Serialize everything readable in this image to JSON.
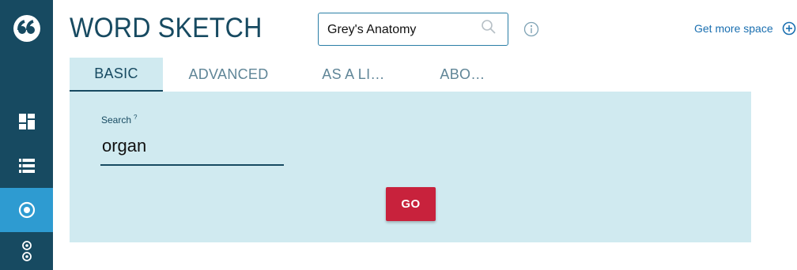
{
  "app": {
    "title": "WORD SKETCH"
  },
  "corpus": {
    "name": "Grey's Anatomy"
  },
  "header": {
    "more_space_label": "Get more space"
  },
  "tabs": [
    {
      "label": "BASIC",
      "active": true
    },
    {
      "label": "ADVANCED",
      "active": false
    },
    {
      "label": "AS A LI…",
      "active": false
    },
    {
      "label": "ABO…",
      "active": false
    }
  ],
  "search": {
    "label": "Search",
    "help_marker": "?",
    "value": "organ"
  },
  "go_button": {
    "label": "GO"
  },
  "sidebar": {
    "items": [
      {
        "icon": "logo-quote-icon"
      },
      {
        "icon": "dashboard-icon"
      },
      {
        "icon": "list-icon"
      },
      {
        "icon": "word-sketch-icon",
        "active": true
      },
      {
        "icon": "thesaurus-icon"
      }
    ]
  },
  "colors": {
    "sidebar": "#174a61",
    "sidebar_active": "#2e9bd1",
    "panel": "#d0eaf0",
    "accent": "#174a61",
    "go_button": "#c8223c",
    "link": "#1a6fb0"
  }
}
